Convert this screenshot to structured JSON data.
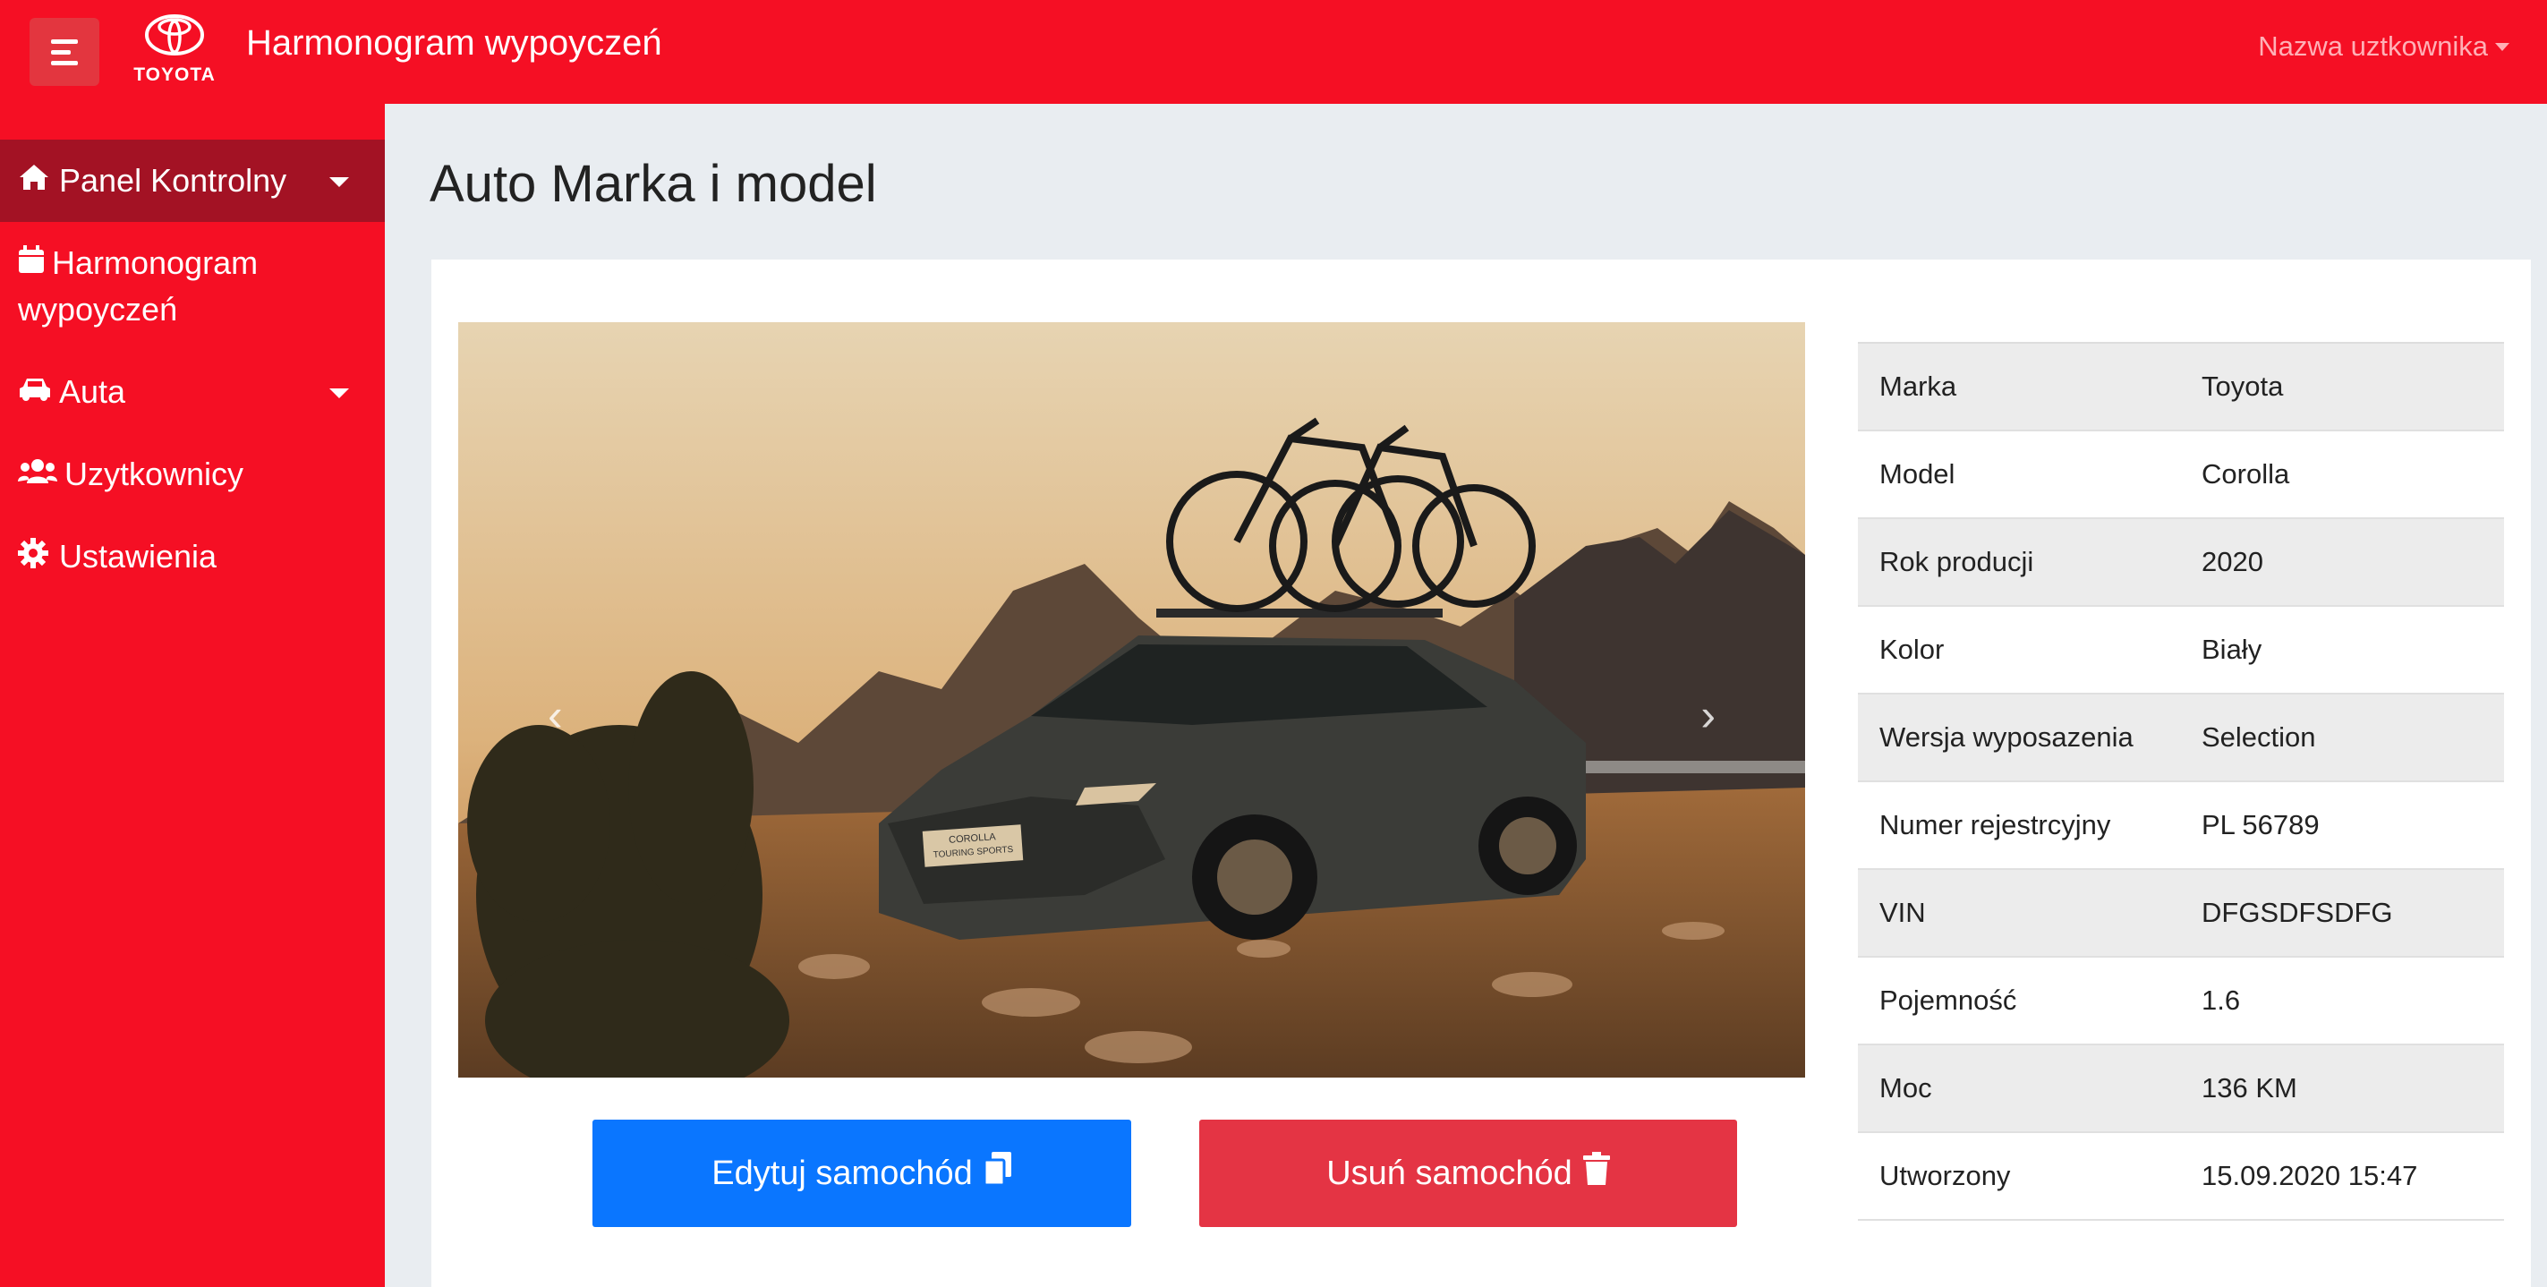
{
  "header": {
    "logo_text": "TOYOTA",
    "title": "Harmonogram wypoyczeń",
    "user_menu": "Nazwa uztkownika"
  },
  "sidebar": {
    "items": [
      {
        "label": "Panel Kontrolny",
        "icon": "home-icon",
        "active": true,
        "has_caret": true
      },
      {
        "label_line1": "Harmonogram",
        "label_line2": "wypoyczeń",
        "icon": "calendar-icon"
      },
      {
        "label": "Auta",
        "icon": "car-icon",
        "has_caret": true
      },
      {
        "label": "Uzytkownicy",
        "icon": "users-icon"
      },
      {
        "label": "Ustawienia",
        "icon": "gear-icon"
      }
    ]
  },
  "main": {
    "title": "Auto Marka i model",
    "photo": {
      "plate_line1": "COROLLA",
      "plate_line2": "TOURING SPORTS"
    },
    "buttons": {
      "edit": "Edytuj samochód",
      "delete": "Usuń samochód"
    },
    "details": [
      {
        "key": "Marka",
        "value": "Toyota"
      },
      {
        "key": "Model",
        "value": "Corolla"
      },
      {
        "key": "Rok producji",
        "value": "2020"
      },
      {
        "key": "Kolor",
        "value": "Biały"
      },
      {
        "key": "Wersja wyposazenia",
        "value": "Selection"
      },
      {
        "key": "Numer rejestrcyjny",
        "value": "PL 56789"
      },
      {
        "key": "VIN",
        "value": "DFGSDFSDFG"
      },
      {
        "key": "Pojemność",
        "value": "1.6"
      },
      {
        "key": "Moc",
        "value": "136 KM"
      },
      {
        "key": "Utworzony",
        "value": "15.09.2020 15:47"
      }
    ]
  },
  "colors": {
    "brand_red": "#f50f24",
    "sidebar_active": "#a31224",
    "edit_blue": "#0a76ff",
    "delete_red": "#e43444"
  }
}
